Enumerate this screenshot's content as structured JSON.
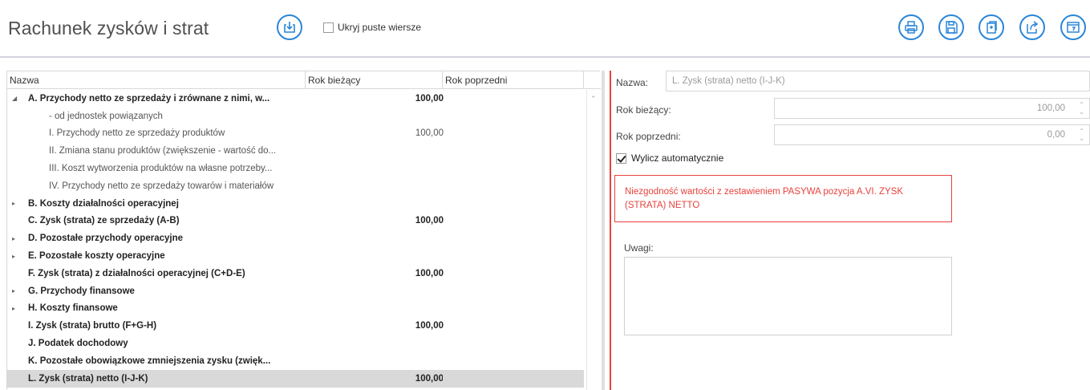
{
  "header": {
    "title": "Rachunek zysków i strat",
    "hide_empty_label": "Ukryj puste wiersze",
    "hide_empty_checked": false,
    "accent_color": "#2a86d8"
  },
  "toolbar_icons": [
    "import-icon",
    "print-icon",
    "save-icon",
    "copy-icon",
    "export-icon",
    "window-icon"
  ],
  "grid": {
    "columns": [
      "Nazwa",
      "Rok bieżący",
      "Rok poprzedni"
    ],
    "rows": [
      {
        "name": "A. Przychody netto ze sprzedaży i zrównane z nimi, w...",
        "current": "100,00",
        "previous": "",
        "bold": true,
        "expander": "expanded",
        "indent": 0
      },
      {
        "name": "- od jednostek powiązanych",
        "current": "",
        "previous": "",
        "bold": false,
        "expander": "none",
        "indent": 1
      },
      {
        "name": "I. Przychody netto ze sprzedaży produktów",
        "current": "100,00",
        "previous": "",
        "bold": false,
        "expander": "none",
        "indent": 1
      },
      {
        "name": "II. Zmiana stanu produktów (zwiększenie - wartość do...",
        "current": "",
        "previous": "",
        "bold": false,
        "expander": "none",
        "indent": 1
      },
      {
        "name": "III. Koszt wytworzenia produktów na własne potrzeby...",
        "current": "",
        "previous": "",
        "bold": false,
        "expander": "none",
        "indent": 1
      },
      {
        "name": "IV. Przychody netto ze sprzedaży towarów i materiałów",
        "current": "",
        "previous": "",
        "bold": false,
        "expander": "none",
        "indent": 1
      },
      {
        "name": "B. Koszty działalności operacyjnej",
        "current": "",
        "previous": "",
        "bold": true,
        "expander": "collapsed",
        "indent": 0
      },
      {
        "name": "C. Zysk (strata) ze sprzedaży (A-B)",
        "current": "100,00",
        "previous": "",
        "bold": true,
        "expander": "none",
        "indent": 0
      },
      {
        "name": "D. Pozostałe przychody operacyjne",
        "current": "",
        "previous": "",
        "bold": true,
        "expander": "collapsed",
        "indent": 0
      },
      {
        "name": "E. Pozostałe koszty operacyjne",
        "current": "",
        "previous": "",
        "bold": true,
        "expander": "collapsed",
        "indent": 0
      },
      {
        "name": "F. Zysk (strata) z działalności operacyjnej (C+D-E)",
        "current": "100,00",
        "previous": "",
        "bold": true,
        "expander": "none",
        "indent": 0
      },
      {
        "name": "G. Przychody finansowe",
        "current": "",
        "previous": "",
        "bold": true,
        "expander": "collapsed",
        "indent": 0
      },
      {
        "name": "H. Koszty finansowe",
        "current": "",
        "previous": "",
        "bold": true,
        "expander": "collapsed",
        "indent": 0
      },
      {
        "name": "I. Zysk (strata) brutto (F+G-H)",
        "current": "100,00",
        "previous": "",
        "bold": true,
        "expander": "none",
        "indent": 0
      },
      {
        "name": "J. Podatek dochodowy",
        "current": "",
        "previous": "",
        "bold": true,
        "expander": "none",
        "indent": 0
      },
      {
        "name": "K. Pozostałe obowiązkowe zmniejszenia zysku (zwięk...",
        "current": "",
        "previous": "",
        "bold": true,
        "expander": "none",
        "indent": 0
      },
      {
        "name": "L. Zysk (strata) netto (I-J-K)",
        "current": "100,00",
        "previous": "",
        "bold": true,
        "expander": "none",
        "indent": 0,
        "selected": true
      }
    ]
  },
  "detail": {
    "name_label": "Nazwa:",
    "name_value": "L. Zysk (strata) netto (I-J-K)",
    "current_label": "Rok bieżący:",
    "current_value": "100,00",
    "previous_label": "Rok poprzedni:",
    "previous_value": "0,00",
    "auto_label": "Wylicz automatycznie",
    "auto_checked": true,
    "error_text": "Niezgodność wartości z zestawieniem PASYWA pozycja A.VI. ZYSK (STRATA) NETTO",
    "error_color": "#e8413c",
    "notes_label": "Uwagi:",
    "notes_value": ""
  }
}
